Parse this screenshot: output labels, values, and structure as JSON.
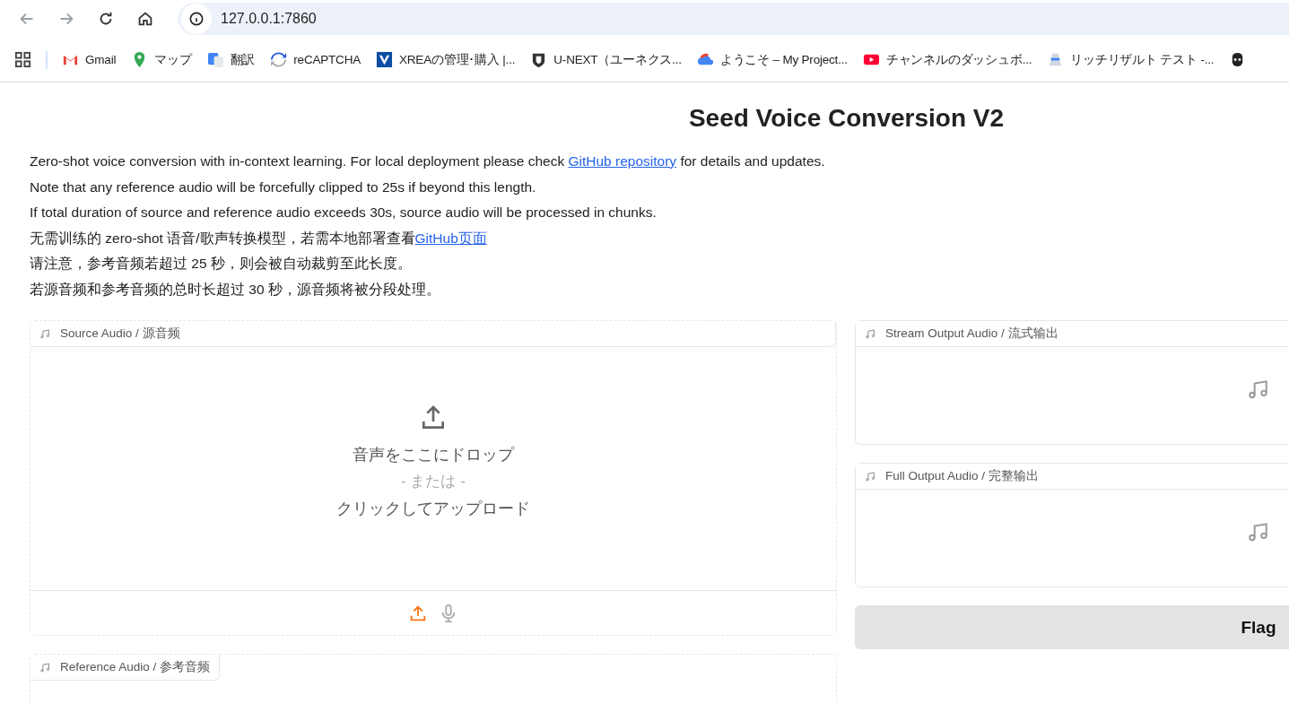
{
  "browser": {
    "url": "127.0.0.1:7860",
    "bookmarks": [
      {
        "label": "Gmail"
      },
      {
        "label": "マップ"
      },
      {
        "label": "翻訳"
      },
      {
        "label": "reCAPTCHA"
      },
      {
        "label": "XREAの管理･購入 |..."
      },
      {
        "label": "U-NEXT（ユーネクス..."
      },
      {
        "label": "ようこそ – My Project..."
      },
      {
        "label": "チャンネルのダッシュボ..."
      },
      {
        "label": "リッチリザルト テスト -..."
      }
    ]
  },
  "title": "Seed Voice Conversion V2",
  "description": [
    {
      "before": "Zero-shot voice conversion with in-context learning. For local deployment please check ",
      "link": "GitHub repository",
      "after": " for details and updates."
    },
    {
      "before": "Note that any reference audio will be forcefully clipped to 25s if beyond this length."
    },
    {
      "before": "If total duration of source and reference audio exceeds 30s, source audio will be processed in chunks."
    },
    {
      "before": "无需训练的 zero-shot 语音/歌声转换模型，若需本地部署查看",
      "link": "GitHub页面"
    },
    {
      "before": "请注意，参考音频若超过 25 秒，则会被自动裁剪至此长度。"
    },
    {
      "before": "若源音频和参考音频的总时长超过 30 秒，源音频将被分段处理。"
    }
  ],
  "source_audio": {
    "label": "Source Audio / 源音频",
    "drop_text": "音声をここにドロップ",
    "or_text": "- または -",
    "click_text": "クリックしてアップロード",
    "input_sources": [
      {
        "kind": "upload",
        "selected": true
      },
      {
        "kind": "microphone",
        "selected": false
      }
    ]
  },
  "reference_audio": {
    "label": "Reference Audio / 参考音频"
  },
  "stream_output": {
    "label": "Stream Output Audio / 流式输出"
  },
  "full_output": {
    "label": "Full Output Audio / 完整输出"
  },
  "flag_button": "Flag"
}
